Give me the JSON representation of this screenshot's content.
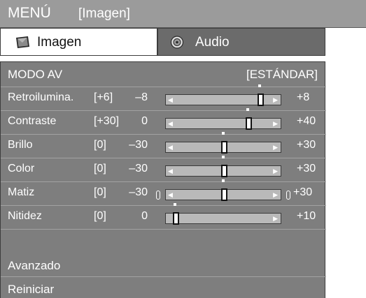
{
  "title": {
    "menu": "MENÚ",
    "section": "[Imagen]"
  },
  "tabs": [
    {
      "label": "Imagen",
      "icon": "picture-icon",
      "active": true
    },
    {
      "label": "Audio",
      "icon": "speaker-icon",
      "active": false
    }
  ],
  "av_mode": {
    "label": "MODO AV",
    "value": "[ESTÁNDAR]"
  },
  "rows": [
    {
      "label": "Retroilumina.",
      "value": "[+6]",
      "min": "–8",
      "max": "+8",
      "level": 6,
      "range": [
        -8,
        8
      ]
    },
    {
      "label": "Contraste",
      "value": "[+30]",
      "min": "0",
      "max": "+40",
      "level": 30,
      "range": [
        0,
        40
      ]
    },
    {
      "label": "Brillo",
      "value": "[0]",
      "min": "–30",
      "max": "+30",
      "level": 0,
      "range": [
        -30,
        30
      ]
    },
    {
      "label": "Color",
      "value": "[0]",
      "min": "–30",
      "max": "+30",
      "level": 0,
      "range": [
        -30,
        30
      ]
    },
    {
      "label": "Matiz",
      "value": "[0]",
      "min": "–30",
      "max": "+30",
      "level": 0,
      "range": [
        -30,
        30
      ]
    },
    {
      "label": "Nitidez",
      "value": "[0]",
      "min": "0",
      "max": "+10",
      "level": 0,
      "range": [
        0,
        10
      ]
    }
  ],
  "advanced": "Avanzado",
  "reset": "Reiniciar",
  "colors": {
    "title_bar": "#9b9b9b",
    "panel": "#7e7e7e",
    "inactive_tab": "#6b6b6b",
    "track": "#b9b9b9"
  }
}
